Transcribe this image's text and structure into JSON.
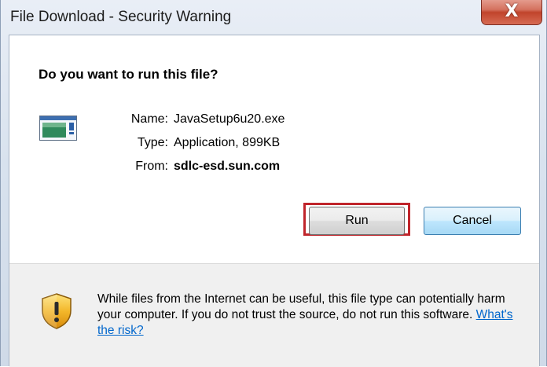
{
  "window": {
    "title": "File Download - Security Warning",
    "close_glyph": "X"
  },
  "dialog": {
    "question": "Do you want to run this file?",
    "file_icon": "application-file-icon",
    "details": [
      {
        "label": "Name:",
        "value": "JavaSetup6u20.exe",
        "bold": false
      },
      {
        "label": "Type:",
        "value": "Application, 899KB",
        "bold": false
      },
      {
        "label": "From:",
        "value": "sdlc-esd.sun.com",
        "bold": true
      }
    ],
    "buttons": {
      "run_label": "Run",
      "cancel_label": "Cancel"
    }
  },
  "warning": {
    "icon": "shield-warning-icon",
    "text": "While files from the Internet can be useful, this file type can potentially harm your computer. If you do not trust the source, do not run this software.",
    "link_text": "What's the risk?"
  },
  "colors": {
    "highlight_box": "#c0252b",
    "link": "#0066cc",
    "close_button": "#c1442c"
  }
}
